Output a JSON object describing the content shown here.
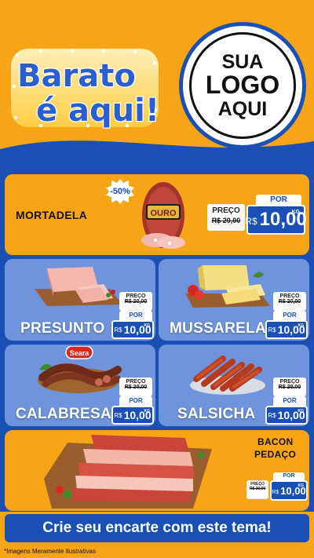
{
  "brand": {
    "line1": "Barato",
    "line2": "é aqui!"
  },
  "logo": {
    "line1": "SUA",
    "line2": "LOGO",
    "line3": "AQUI"
  },
  "products": {
    "mortadela": {
      "name": "MORTADELA",
      "discount": "-50%",
      "preco_label": "PREÇO",
      "old_price": "R$ 20,00",
      "por_label": "POR",
      "currency": "R$",
      "price": "10,00",
      "unit": "KG",
      "image_label": "OURO"
    },
    "presunto": {
      "name": "PRESUNTO",
      "preco_label": "PREÇO",
      "old_price": "R$ 20,00",
      "por_label": "POR",
      "currency": "R$",
      "price": "10,00",
      "unit": "KG"
    },
    "mussarela": {
      "name": "MUSSARELA",
      "preco_label": "PREÇO",
      "old_price": "R$ 20,00",
      "por_label": "POR",
      "currency": "R$",
      "price": "10,00",
      "unit": "KG"
    },
    "calabresa": {
      "name": "CALABRESA",
      "preco_label": "PREÇO",
      "old_price": "R$ 20,00",
      "por_label": "POR",
      "currency": "R$",
      "price": "10,00",
      "unit": "KG",
      "image_label": "Seara"
    },
    "salsicha": {
      "name": "SALSICHA",
      "preco_label": "PREÇO",
      "old_price": "R$ 20,00",
      "por_label": "POR",
      "currency": "R$",
      "price": "10,00",
      "unit": "KG"
    },
    "bacon": {
      "name_line1": "BACON",
      "name_line2": "PEDAÇO",
      "preco_label": "PREÇO",
      "old_price": "R$ 20,00",
      "por_label": "POR",
      "currency": "R$",
      "price": "10,00",
      "unit": "KG"
    }
  },
  "cta": {
    "label": "Crie seu encarte com este tema!"
  },
  "footnote": "*Imagens Meramente Ilustrativas",
  "colors": {
    "orange": "#f7a516",
    "blue": "#1a4fb6",
    "light_blue": "#6f93dc",
    "white": "#ffffff"
  }
}
